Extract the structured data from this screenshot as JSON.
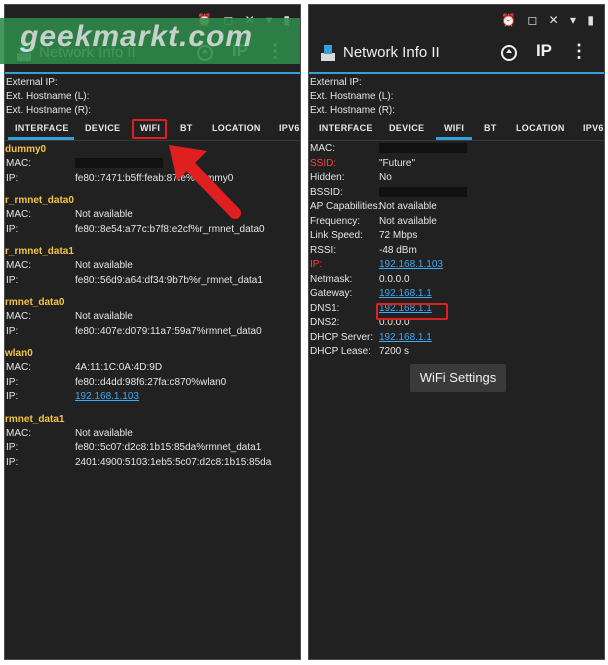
{
  "app": {
    "title": "Network Info II",
    "ip_button": "IP"
  },
  "watermark": "geekmarkt.com",
  "status_icons": "⏰ ◻ ✕ ▾ ▮",
  "header_info": {
    "external_ip": "External IP:",
    "ext_hostname_l": "Ext. Hostname (L):",
    "ext_hostname_r": "Ext. Hostname (R):"
  },
  "tabs": [
    "INTERFACE",
    "DEVICE",
    "WIFI",
    "BT",
    "LOCATION",
    "IPV6"
  ],
  "left_panel": {
    "active_tab": "INTERFACE",
    "sections": [
      {
        "name": "dummy0",
        "rows": [
          {
            "k": "MAC:",
            "v": ""
          },
          {
            "k": "IP:",
            "v": "fe80::7471:b5ff:feab:87fe%dummy0"
          }
        ]
      },
      {
        "name": "r_rmnet_data0",
        "rows": [
          {
            "k": "MAC:",
            "v": "Not available"
          },
          {
            "k": "IP:",
            "v": "fe80::8e54:a77c:b7f8:e2cf%r_rmnet_data0"
          }
        ]
      },
      {
        "name": "r_rmnet_data1",
        "rows": [
          {
            "k": "MAC:",
            "v": "Not available"
          },
          {
            "k": "IP:",
            "v": "fe80::56d9:a64:df34:9b7b%r_rmnet_data1"
          }
        ]
      },
      {
        "name": "rmnet_data0",
        "rows": [
          {
            "k": "MAC:",
            "v": "Not available"
          },
          {
            "k": "IP:",
            "v": "fe80::407e:d079:11a7:59a7%rmnet_data0"
          }
        ]
      },
      {
        "name": "wlan0",
        "rows": [
          {
            "k": "MAC:",
            "v": "4A:11:1C:0A:4D:9D"
          },
          {
            "k": "IP:",
            "v": "fe80::d4dd:98f6:27fa:c870%wlan0"
          },
          {
            "k": "IP:",
            "v": "192.168.1.103"
          }
        ]
      },
      {
        "name": "rmnet_data1",
        "rows": [
          {
            "k": "MAC:",
            "v": "Not available"
          },
          {
            "k": "IP:",
            "v": "fe80::5c07:d2c8:1b15:85da%rmnet_data1"
          },
          {
            "k": "IP:",
            "v": "2401:4900:5103:1eb5:5c07:d2c8:1b15:85da"
          }
        ]
      }
    ]
  },
  "right_panel": {
    "active_tab": "WIFI",
    "rows": [
      {
        "k": "MAC:",
        "v": ""
      },
      {
        "k": "SSID:",
        "v": "\"Future\""
      },
      {
        "k": "Hidden:",
        "v": "No"
      },
      {
        "k": "BSSID:",
        "v": ""
      },
      {
        "k": "AP Capabilities:",
        "v": "Not available"
      },
      {
        "k": "Frequency:",
        "v": "Not available"
      },
      {
        "k": "Link Speed:",
        "v": "72 Mbps"
      },
      {
        "k": "RSSI:",
        "v": "-48 dBm"
      },
      {
        "k": "IP:",
        "v": "192.168.1.103"
      },
      {
        "k": "Netmask:",
        "v": "0.0.0.0"
      },
      {
        "k": "Gateway:",
        "v": "192.168.1.1"
      },
      {
        "k": "DNS1:",
        "v": "192.168.1.1"
      },
      {
        "k": "DNS2:",
        "v": "0.0.0.0"
      },
      {
        "k": "DHCP Server:",
        "v": "192.168.1.1"
      },
      {
        "k": "DHCP Lease:",
        "v": "7200 s"
      }
    ],
    "wifi_settings_button": "WiFi Settings"
  },
  "colors": {
    "accent": "#35a0d8",
    "section": "#f5c542",
    "link": "#3fa9f5",
    "highlight": "#e02020"
  }
}
